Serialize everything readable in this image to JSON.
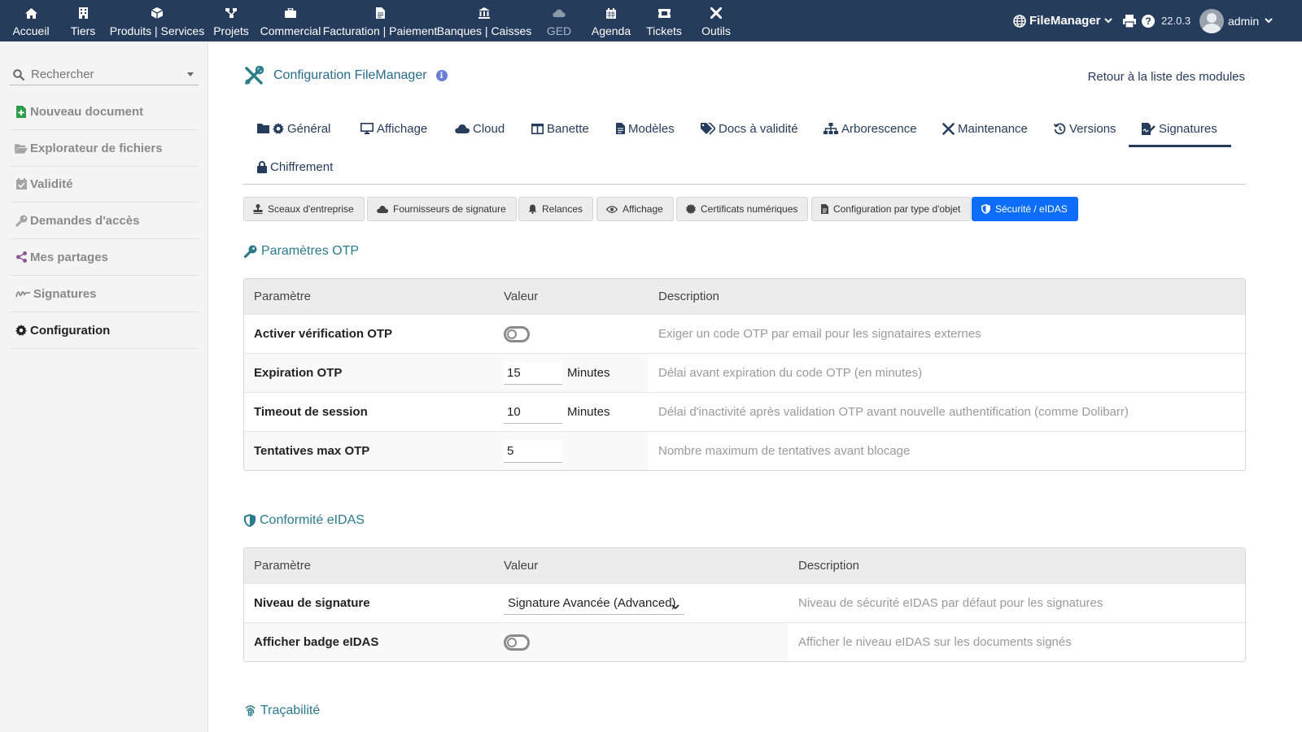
{
  "topnav": {
    "items": [
      {
        "label": "Accueil",
        "icon": "home-icon"
      },
      {
        "label": "Tiers",
        "icon": "building-icon"
      },
      {
        "label": "Produits | Services",
        "icon": "cube-icon"
      },
      {
        "label": "Projets",
        "icon": "sitemap-icon"
      },
      {
        "label": "Commercial",
        "icon": "suitcase-icon"
      },
      {
        "label": "Facturation | Paiement",
        "icon": "invoice-icon"
      },
      {
        "label": "Banques | Caisses",
        "icon": "bank-icon"
      },
      {
        "label": "GED",
        "icon": "cloud-icon"
      },
      {
        "label": "Agenda",
        "icon": "calendar-icon"
      },
      {
        "label": "Tickets",
        "icon": "ticket-icon"
      },
      {
        "label": "Outils",
        "icon": "tools-icon"
      }
    ],
    "filemanager_label": "FileManager",
    "version": "22.0.3",
    "user": "admin"
  },
  "sidebar": {
    "search_placeholder": "Rechercher",
    "items": [
      {
        "label": "Nouveau document",
        "icon": "new-file-icon"
      },
      {
        "label": "Explorateur de fichiers",
        "icon": "folder-open-icon"
      },
      {
        "label": "Validité",
        "icon": "calendar-check-icon"
      },
      {
        "label": "Demandes d'accès",
        "icon": "key-icon"
      },
      {
        "label": "Mes partages",
        "icon": "share-icon"
      },
      {
        "label": "Signatures",
        "icon": "signature-icon"
      },
      {
        "label": "Configuration",
        "icon": "gear-icon"
      }
    ]
  },
  "page": {
    "title": "Configuration FileManager",
    "back_link": "Retour à la liste des modules"
  },
  "tabs": [
    {
      "label": "Général"
    },
    {
      "label": "Affichage"
    },
    {
      "label": "Cloud"
    },
    {
      "label": "Banette"
    },
    {
      "label": "Modèles"
    },
    {
      "label": "Docs à validité"
    },
    {
      "label": "Arborescence"
    },
    {
      "label": "Maintenance"
    },
    {
      "label": "Versions"
    },
    {
      "label": "Signatures"
    },
    {
      "label": "Chiffrement"
    }
  ],
  "subtabs": [
    {
      "label": "Sceaux d'entreprise"
    },
    {
      "label": "Fournisseurs de signature"
    },
    {
      "label": "Relances"
    },
    {
      "label": "Affichage"
    },
    {
      "label": "Certificats numériques"
    },
    {
      "label": "Configuration par type d'objet"
    },
    {
      "label": "Sécurité / eIDAS"
    }
  ],
  "otp": {
    "title": "Paramètres OTP",
    "headers": {
      "param": "Paramètre",
      "value": "Valeur",
      "desc": "Description"
    },
    "rows": [
      {
        "label": "Activer vérification OTP",
        "toggle": false,
        "desc": "Exiger un code OTP par email pour les signataires externes"
      },
      {
        "label": "Expiration OTP",
        "value": "15",
        "unit": "Minutes",
        "desc": "Délai avant expiration du code OTP (en minutes)"
      },
      {
        "label": "Timeout de session",
        "value": "10",
        "unit": "Minutes",
        "desc": "Délai d'inactivité après validation OTP avant nouvelle authentification (comme Dolibarr)"
      },
      {
        "label": "Tentatives max OTP",
        "value": "5",
        "desc": "Nombre maximum de tentatives avant blocage"
      }
    ]
  },
  "eidas": {
    "title": "Conformité eIDAS",
    "headers": {
      "param": "Paramètre",
      "value": "Valeur",
      "desc": "Description"
    },
    "rows": [
      {
        "label": "Niveau de signature",
        "select": "Signature Avancée (Advanced)",
        "desc": "Niveau de sécurité eIDAS par défaut pour les signatures"
      },
      {
        "label": "Afficher badge eIDAS",
        "toggle": false,
        "desc": "Afficher le niveau eIDAS sur les documents signés"
      }
    ]
  },
  "trace": {
    "title": "Traçabilité"
  },
  "colors": {
    "topbar": "#263c5c",
    "accent_blue": "#0d6efd",
    "section_teal": "#2a7a8c"
  }
}
